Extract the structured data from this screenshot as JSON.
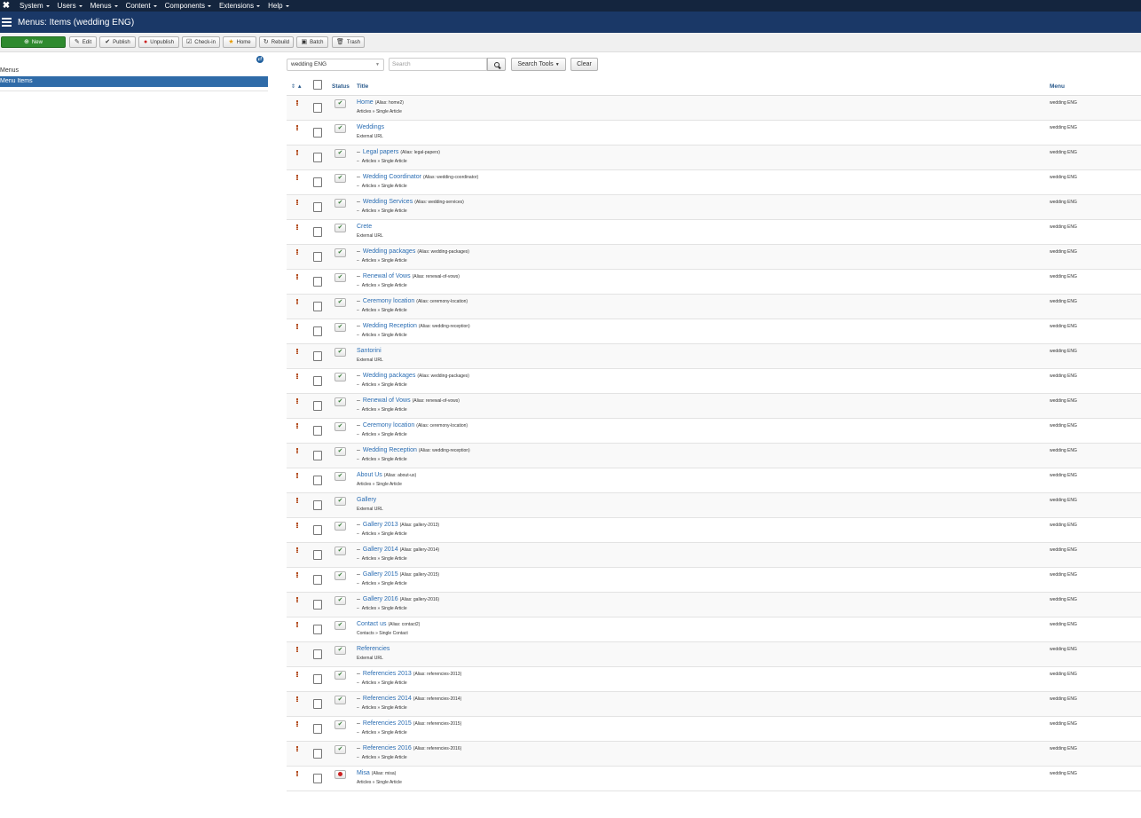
{
  "topnav": {
    "logo": "✖",
    "items": [
      "System",
      "Users",
      "Menus",
      "Content",
      "Components",
      "Extensions",
      "Help"
    ]
  },
  "header": {
    "title": "Menus: Items (wedding ENG)"
  },
  "toolbar": {
    "new": "New",
    "edit": "Edit",
    "publish": "Publish",
    "unpublish": "Unpublish",
    "checkin": "Check-in",
    "home": "Home",
    "rebuild": "Rebuild",
    "batch": "Batch",
    "trash": "Trash"
  },
  "sidebar": {
    "menus": "Menus",
    "menu_items": "Menu Items"
  },
  "filters": {
    "menu_select": "wedding ENG",
    "search_placeholder": "Search",
    "search_tools": "Search Tools",
    "clear": "Clear"
  },
  "table": {
    "headers": {
      "status": "Status",
      "title": "Title",
      "menu": "Menu"
    },
    "rows": [
      {
        "title": "Home",
        "alias": "(Alias: home2)",
        "type": "Articles » Single Article",
        "child": false,
        "published": true,
        "menu": "wedding ENG"
      },
      {
        "title": "Weddings",
        "alias": "",
        "type": "External URL",
        "child": false,
        "published": true,
        "menu": "wedding ENG"
      },
      {
        "title": "Legal papers",
        "alias": "(Alias: legal-papers)",
        "type": "Articles » Single Article",
        "child": true,
        "published": true,
        "menu": "wedding ENG"
      },
      {
        "title": "Wedding Coordinator",
        "alias": "(Alias: wedding-coordinator)",
        "type": "Articles » Single Article",
        "child": true,
        "published": true,
        "menu": "wedding ENG"
      },
      {
        "title": "Wedding Services",
        "alias": "(Alias: wedding-services)",
        "type": "Articles » Single Article",
        "child": true,
        "published": true,
        "menu": "wedding ENG"
      },
      {
        "title": "Crete",
        "alias": "",
        "type": "External URL",
        "child": false,
        "published": true,
        "menu": "wedding ENG"
      },
      {
        "title": "Wedding packages",
        "alias": "(Alias: wedding-packages)",
        "type": "Articles » Single Article",
        "child": true,
        "published": true,
        "menu": "wedding ENG"
      },
      {
        "title": "Renewal of Vows",
        "alias": "(Alias: renewal-of-vows)",
        "type": "Articles » Single Article",
        "child": true,
        "published": true,
        "menu": "wedding ENG"
      },
      {
        "title": "Ceremony location",
        "alias": "(Alias: ceremony-location)",
        "type": "Articles » Single Article",
        "child": true,
        "published": true,
        "menu": "wedding ENG"
      },
      {
        "title": "Wedding Reception",
        "alias": "(Alias: wedding-reception)",
        "type": "Articles » Single Article",
        "child": true,
        "published": true,
        "menu": "wedding ENG"
      },
      {
        "title": "Santorini",
        "alias": "",
        "type": "External URL",
        "child": false,
        "published": true,
        "menu": "wedding ENG"
      },
      {
        "title": "Wedding packages",
        "alias": "(Alias: wedding-packages)",
        "type": "Articles » Single Article",
        "child": true,
        "published": true,
        "menu": "wedding ENG"
      },
      {
        "title": "Renewal of Vows",
        "alias": "(Alias: renewal-of-vows)",
        "type": "Articles » Single Article",
        "child": true,
        "published": true,
        "menu": "wedding ENG"
      },
      {
        "title": "Ceremony location",
        "alias": "(Alias: ceremony-location)",
        "type": "Articles » Single Article",
        "child": true,
        "published": true,
        "menu": "wedding ENG"
      },
      {
        "title": "Wedding Reception",
        "alias": "(Alias: wedding-reception)",
        "type": "Articles » Single Article",
        "child": true,
        "published": true,
        "menu": "wedding ENG"
      },
      {
        "title": "About Us",
        "alias": "(Alias: about-us)",
        "type": "Articles » Single Article",
        "child": false,
        "published": true,
        "menu": "wedding ENG"
      },
      {
        "title": "Gallery",
        "alias": "",
        "type": "External URL",
        "child": false,
        "published": true,
        "menu": "wedding ENG"
      },
      {
        "title": "Gallery 2013",
        "alias": "(Alias: gallery-2013)",
        "type": "Articles » Single Article",
        "child": true,
        "published": true,
        "menu": "wedding ENG"
      },
      {
        "title": "Gallery 2014",
        "alias": "(Alias: gallery-2014)",
        "type": "Articles » Single Article",
        "child": true,
        "published": true,
        "menu": "wedding ENG"
      },
      {
        "title": "Gallery 2015",
        "alias": "(Alias: gallery-2015)",
        "type": "Articles » Single Article",
        "child": true,
        "published": true,
        "menu": "wedding ENG"
      },
      {
        "title": "Gallery 2016",
        "alias": "(Alias: gallery-2016)",
        "type": "Articles » Single Article",
        "child": true,
        "published": true,
        "menu": "wedding ENG"
      },
      {
        "title": "Contact us",
        "alias": "(Alias: contact2)",
        "type": "Contacts » Single Contact",
        "child": false,
        "published": true,
        "menu": "wedding ENG"
      },
      {
        "title": "Referencies",
        "alias": "",
        "type": "External URL",
        "child": false,
        "published": true,
        "menu": "wedding ENG"
      },
      {
        "title": "Referencies 2013",
        "alias": "(Alias: referencies-2013)",
        "type": "Articles » Single Article",
        "child": true,
        "published": true,
        "menu": "wedding ENG"
      },
      {
        "title": "Referencies 2014",
        "alias": "(Alias: referencies-2014)",
        "type": "Articles » Single Article",
        "child": true,
        "published": true,
        "menu": "wedding ENG"
      },
      {
        "title": "Referencies 2015",
        "alias": "(Alias: referencies-2015)",
        "type": "Articles » Single Article",
        "child": true,
        "published": true,
        "menu": "wedding ENG"
      },
      {
        "title": "Referencies 2016",
        "alias": "(Alias: referencies-2016)",
        "type": "Articles » Single Article",
        "child": true,
        "published": true,
        "menu": "wedding ENG"
      },
      {
        "title": "Misa",
        "alias": "(Alias: misa)",
        "type": "Articles » Single Article",
        "child": false,
        "published": false,
        "menu": "wedding ENG"
      }
    ]
  }
}
